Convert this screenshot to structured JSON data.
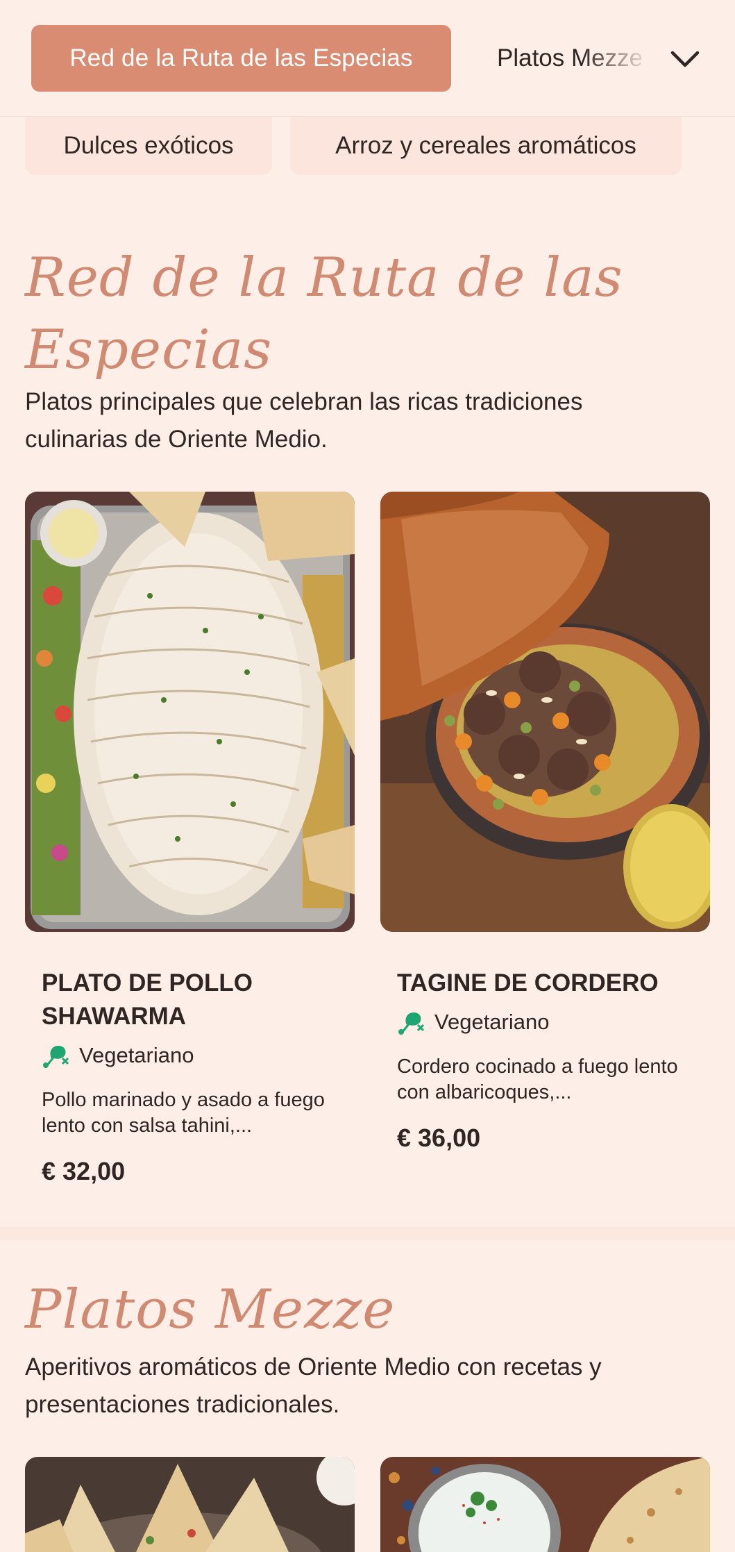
{
  "header": {
    "active_tab": "Red de la Ruta de las Especias",
    "next_tab": "Platos Mezze"
  },
  "categories": [
    "Dulces exóticos",
    "Arroz y cereales aromáticos"
  ],
  "sections": [
    {
      "title": "Red de la Ruta de las Especias",
      "description": "Platos principales que celebran las ricas tradiciones culinarias de Oriente Medio.",
      "items": [
        {
          "name": "PLATO DE POLLO SHAWARMA",
          "badge": "Vegetariano",
          "description": "Pollo marinado y asado a fuego lento con salsa tahini,...",
          "price": "€ 32,00"
        },
        {
          "name": "TAGINE DE CORDERO",
          "badge": "Vegetariano",
          "description": "Cordero cocinado a fuego lento con albaricoques,...",
          "price": "€ 36,00"
        }
      ]
    },
    {
      "title": "Platos Mezze",
      "description": "Aperitivos aromáticos de Oriente Medio con recetas y presentaciones tradicionales."
    }
  ],
  "colors": {
    "accent": "#d98c72",
    "background": "#fdeee8",
    "veg_icon": "#1ea672"
  }
}
